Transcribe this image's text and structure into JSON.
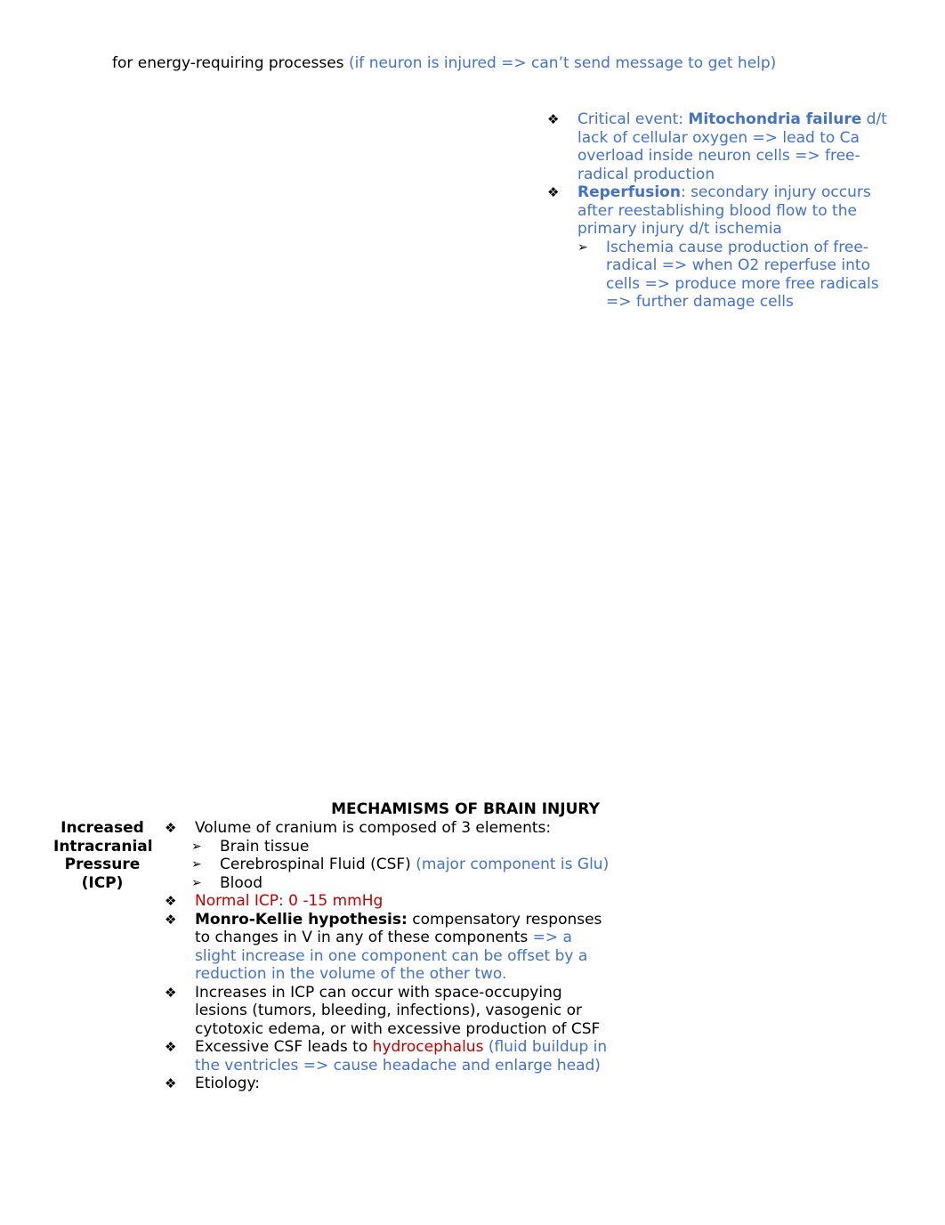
{
  "top_line": {
    "black": "for energy-requiring processes",
    "blue": "(if neuron is injured => can’t send message to get help)"
  },
  "right_column": {
    "item1": {
      "prefix": "Critical event: ",
      "bold": "Mitochondria failure",
      "rest": "d/t lack of cellular oxygen => lead to Ca overload inside neuron cells => free-radical production"
    },
    "item2": {
      "bold": "Reperfusion",
      "rest": ": secondary injury occurs after reestablishing blood flow to the primary injury d/t ischemia",
      "sub": "Ischemia cause production of free-radical => when O2 reperfuse into cells => produce more free radicals => further damage cells"
    }
  },
  "section": {
    "heading": "MECHAMISMS OF BRAIN INJURY",
    "side_label": "Increased Intracranial Pressure (ICP)",
    "items": {
      "volume": "Volume of cranium is composed of 3 elements:",
      "elements": {
        "brain": "Brain tissue",
        "csf": "Cerebrospinal Fluid (CSF)",
        "csf_note": "(major component is Glu)",
        "blood": "Blood"
      },
      "normal_icp": "Normal ICP: 0 -15 mmHg",
      "monro": {
        "bold": "Monro-Kellie hypothesis:",
        "black": " compensatory responses to changes in V in any of these components ",
        "blue": "=> a slight increase in one component can be offset by a reduction in the volume of the other two."
      },
      "increases": "Increases in ICP can occur with space-occupying lesions (tumors, bleeding, infections), vasogenic or cytotoxic edema, or with excessive production of CSF",
      "excess": {
        "black": "Excessive CSF leads to ",
        "red": "hydrocephalus",
        "blue": " (fluid buildup in the ventricles => cause headache and enlarge head)"
      },
      "etiology": "Etiology:"
    }
  },
  "glyphs": {
    "diamond_bullet": "❖",
    "arrow_bullet": "➢"
  },
  "colors": {
    "blue": "#4472c4",
    "red": "#c00000"
  }
}
